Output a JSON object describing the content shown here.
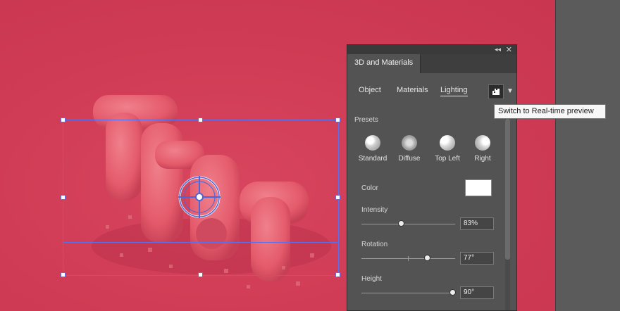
{
  "panel": {
    "tab_label": "3D and Materials",
    "subtabs": [
      {
        "label": "Object"
      },
      {
        "label": "Materials"
      },
      {
        "label": "Lighting"
      }
    ],
    "presets_label": "Presets",
    "presets": [
      {
        "label": "Standard"
      },
      {
        "label": "Diffuse"
      },
      {
        "label": "Top Left"
      },
      {
        "label": "Right"
      }
    ],
    "color_label": "Color",
    "color_value": "#ffffff",
    "intensity_label": "Intensity",
    "intensity_value": "83%",
    "rotation_label": "Rotation",
    "rotation_value": "77°",
    "height_label": "Height",
    "height_value": "90°",
    "collapse_glyph": "◂◂",
    "close_glyph": "✕"
  },
  "tooltip": {
    "text": "Switch to Real-time preview"
  },
  "icons": {
    "preview": "realtime-preview-icon",
    "chevron": "chevron-down-icon"
  },
  "colors": {
    "canvas_bg": "#d23d56",
    "panel_bg": "#535353",
    "selection": "#5c6ee8",
    "text_art": "#e8606f"
  }
}
